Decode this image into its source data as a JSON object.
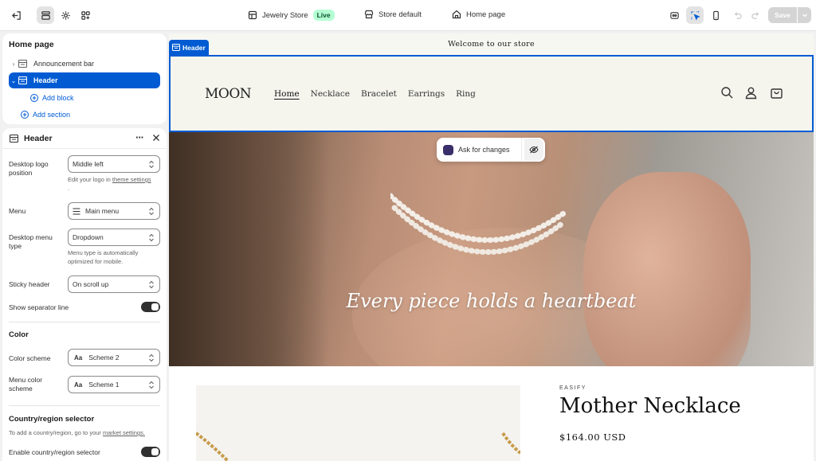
{
  "topbar": {
    "store_name": "Jewelry Store",
    "store_status": "Live",
    "theme_name": "Store default",
    "page_selector": "Home page",
    "save_label": "Save"
  },
  "sidebar": {
    "title": "Home page",
    "sections": [
      {
        "label": "Announcement bar"
      },
      {
        "label": "Header"
      }
    ],
    "add_block_label": "Add block",
    "add_section_label": "Add section"
  },
  "settings": {
    "title": "Header",
    "fields": {
      "logo_position": {
        "label": "Desktop logo position",
        "value": "Middle left",
        "help_prefix": "Edit your logo in ",
        "help_link": "theme settings",
        "help_suffix": "."
      },
      "menu": {
        "label": "Menu",
        "value": "Main menu"
      },
      "menu_type": {
        "label": "Desktop menu type",
        "value": "Dropdown",
        "help": "Menu type is automatically optimized for mobile."
      },
      "sticky_header": {
        "label": "Sticky header",
        "value": "On scroll up"
      },
      "separator": {
        "label": "Show separator line",
        "enabled": true
      }
    },
    "color_section": {
      "title": "Color",
      "color_scheme": {
        "label": "Color scheme",
        "value": "Scheme 2",
        "swatch": "Aa"
      },
      "menu_color_scheme": {
        "label": "Menu color scheme",
        "value": "Scheme 1",
        "swatch": "Aa"
      }
    },
    "country_section": {
      "title": "Country/region selector",
      "help_prefix": "To add a country/region, go to your ",
      "help_link": "market settings.",
      "enable_label": "Enable country/region selector",
      "enabled": true
    }
  },
  "preview": {
    "announcement": "Welcome to our store",
    "header_tag": "Header",
    "logo": "MOON",
    "nav": [
      "Home",
      "Necklace",
      "Bracelet",
      "Earrings",
      "Ring"
    ],
    "hero_text": "Every piece holds a heartbeat",
    "ask_label": "Ask for changes",
    "product": {
      "brand": "EASIFY",
      "title": "Mother Necklace",
      "price": "$164.00 USD"
    }
  },
  "colors": {
    "accent": "#005bd3",
    "live_badge_bg": "#b4fed2",
    "header_bg": "#f5f5ee"
  }
}
